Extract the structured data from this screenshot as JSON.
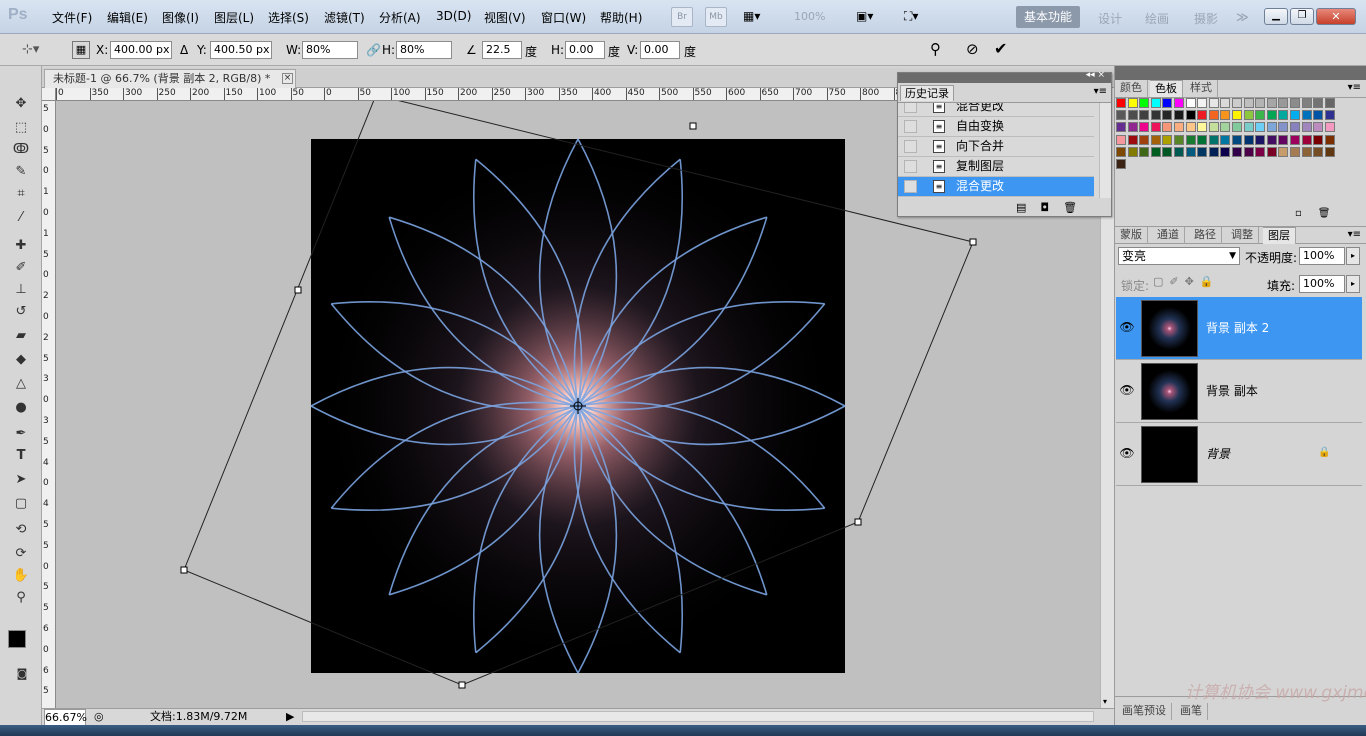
{
  "menubar": {
    "logo": "Ps",
    "items": [
      "文件(F)",
      "编辑(E)",
      "图像(I)",
      "图层(L)",
      "选择(S)",
      "滤镜(T)",
      "分析(A)",
      "3D(D)",
      "视图(V)",
      "窗口(W)",
      "帮助(H)"
    ],
    "bridge": "Br",
    "minibridge": "Mb",
    "zoom": "100%",
    "workspace_active": "基本功能",
    "workspaces": [
      "设计",
      "绘画",
      "摄影"
    ],
    "more": "≫"
  },
  "options": {
    "x_label": "X:",
    "x_value": "400.00 px",
    "y_label": "Y:",
    "y_value": "400.50 px",
    "w_label": "W:",
    "w_value": "80%",
    "h_label": "H:",
    "h_value": "80%",
    "angle_value": "22.5",
    "angle_unit": "度",
    "hskew_label": "H:",
    "hskew_value": "0.00",
    "hskew_unit": "度",
    "vskew_label": "V:",
    "vskew_value": "0.00",
    "vskew_unit": "度"
  },
  "document": {
    "tab_title": "未标题-1 @ 66.7% (背景 副本 2, RGB/8) *",
    "close": "×",
    "ruler_h": [
      "0",
      "350",
      "300",
      "250",
      "200",
      "150",
      "100",
      "50",
      "0",
      "50",
      "100",
      "150",
      "200",
      "250",
      "300",
      "350",
      "400",
      "450",
      "500",
      "550",
      "600",
      "650",
      "700",
      "750",
      "800",
      "850"
    ],
    "ruler_v": [
      "5",
      "0",
      "5",
      "0",
      "1",
      "0",
      "1",
      "5",
      "0",
      "2",
      "0",
      "2",
      "5",
      "3",
      "0",
      "3",
      "5",
      "4",
      "0",
      "4",
      "5",
      "5",
      "0",
      "5",
      "5",
      "6",
      "0",
      "6",
      "5"
    ]
  },
  "status": {
    "zoom": "66.67%",
    "doc_info": "文档:1.83M/9.72M"
  },
  "history": {
    "title": "历史记录",
    "items": [
      "混合更改",
      "自由变换",
      "向下合并",
      "复制图层",
      "混合更改"
    ],
    "active_index": 4
  },
  "swatch_panel": {
    "tabs": [
      "颜色",
      "色板",
      "样式"
    ],
    "active_tab": "色板",
    "colors": [
      "#ff0000",
      "#ffff00",
      "#00ff00",
      "#00ffff",
      "#0000ff",
      "#ff00ff",
      "#ffffff",
      "#f2f2f2",
      "#e6e6e6",
      "#d9d9d9",
      "#cccccc",
      "#bfbfbf",
      "#b3b3b3",
      "#a6a6a6",
      "#999999",
      "#8c8c8c",
      "#808080",
      "#737373",
      "#666666",
      "#595959",
      "#4d4d4d",
      "#404040",
      "#333333",
      "#262626",
      "#1a1a1a",
      "#000000",
      "#ed1c24",
      "#f26522",
      "#f7941d",
      "#fff200",
      "#8dc63f",
      "#39b54a",
      "#00a651",
      "#00a99d",
      "#00aeef",
      "#0072bc",
      "#0054a6",
      "#2e3192",
      "#662d91",
      "#92278f",
      "#ec008c",
      "#ed145b",
      "#f69679",
      "#f9ad81",
      "#fdc689",
      "#fff799",
      "#c4df9b",
      "#a3d39c",
      "#82ca9c",
      "#7accc8",
      "#6dcff6",
      "#7da7d9",
      "#8393ca",
      "#8781bd",
      "#a186be",
      "#bd8cbf",
      "#f49ac1",
      "#f5989d",
      "#9e0b0f",
      "#a0410d",
      "#a36209",
      "#aba000",
      "#598527",
      "#197b30",
      "#007236",
      "#00746b",
      "#0076a3",
      "#004a80",
      "#003471",
      "#1b1464",
      "#440e62",
      "#630460",
      "#9e005d",
      "#9e0039",
      "#790000",
      "#7b2e00",
      "#7d4900",
      "#827b00",
      "#406618",
      "#005e20",
      "#005826",
      "#005952",
      "#005b7f",
      "#003663",
      "#002157",
      "#0d004c",
      "#32004b",
      "#4b0049",
      "#7b0046",
      "#7a0026",
      "#c69c6d",
      "#a67c52",
      "#8c6239",
      "#754c24",
      "#603913",
      "#3c2415"
    ]
  },
  "layers_panel": {
    "tabs": [
      "蒙版",
      "通道",
      "路径",
      "调整",
      "图层"
    ],
    "active_tab": "图层",
    "blend_mode": "变亮",
    "opacity_label": "不透明度:",
    "opacity": "100%",
    "lock_label": "锁定:",
    "fill_label": "填充:",
    "fill": "100%",
    "layers": [
      {
        "name": "背景 副本 2",
        "active": true
      },
      {
        "name": "背景 副本",
        "active": false
      },
      {
        "name": "背景",
        "active": false
      }
    ]
  },
  "brush_tabs": [
    "画笔预设",
    "画笔"
  ],
  "watermark": "计算机协会 www.gxjmca.com"
}
